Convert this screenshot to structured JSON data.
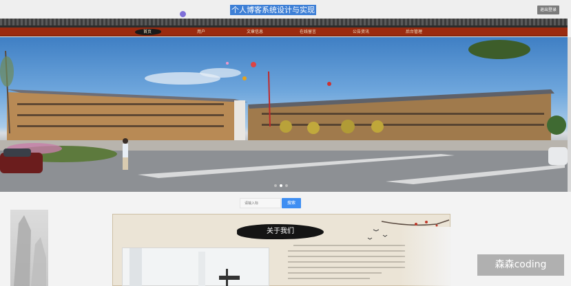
{
  "header": {
    "site_title": "个人博客系统设计与实现",
    "logout_label": "退出登录"
  },
  "nav": {
    "items": [
      {
        "label": "首页",
        "active": true
      },
      {
        "label": "用户"
      },
      {
        "label": "文章信息"
      },
      {
        "label": "在线留言"
      },
      {
        "label": "公告资讯"
      },
      {
        "label": "后台管理"
      }
    ]
  },
  "carousel": {
    "slide_count": 3,
    "active_index": 1
  },
  "search": {
    "placeholder": "请输入标",
    "button_label": "搜索"
  },
  "about": {
    "title": "关于我们"
  },
  "watermark": "森森coding",
  "colors": {
    "nav_bg": "#9a2b10",
    "title_highlight": "#3d7fd6",
    "search_button": "#3e8ef2"
  }
}
